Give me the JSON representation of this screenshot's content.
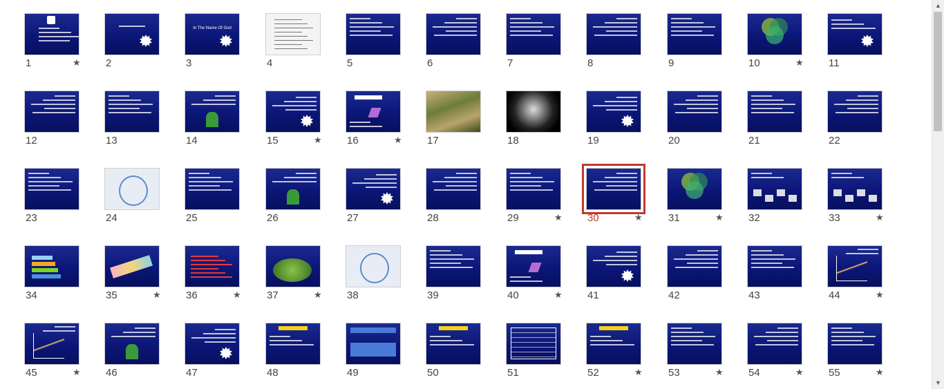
{
  "view": "slide-sorter",
  "selected_slide": "30",
  "star_glyph": "★",
  "colors": {
    "selection": "#c0392b",
    "slide_bg": "#0b1677"
  },
  "scrollbar": {
    "up_icon": "▲",
    "down_icon": "▼"
  },
  "slides": [
    {
      "n": "1",
      "star": true,
      "kind": "title-logo"
    },
    {
      "n": "2",
      "star": false,
      "kind": "title-burst"
    },
    {
      "n": "3",
      "star": false,
      "kind": "title-burst",
      "text": "In The Name Of God"
    },
    {
      "n": "4",
      "star": false,
      "kind": "document"
    },
    {
      "n": "5",
      "star": false,
      "kind": "text"
    },
    {
      "n": "6",
      "star": false,
      "kind": "text"
    },
    {
      "n": "7",
      "star": false,
      "kind": "text"
    },
    {
      "n": "8",
      "star": false,
      "kind": "text"
    },
    {
      "n": "9",
      "star": false,
      "kind": "text"
    },
    {
      "n": "10",
      "star": true,
      "kind": "venn"
    },
    {
      "n": "11",
      "star": false,
      "kind": "table-burst"
    },
    {
      "n": "12",
      "star": false,
      "kind": "text"
    },
    {
      "n": "13",
      "star": false,
      "kind": "text"
    },
    {
      "n": "14",
      "star": false,
      "kind": "figure"
    },
    {
      "n": "15",
      "star": true,
      "kind": "text-burst"
    },
    {
      "n": "16",
      "star": true,
      "kind": "diagram"
    },
    {
      "n": "17",
      "star": false,
      "kind": "photo-palm"
    },
    {
      "n": "18",
      "star": false,
      "kind": "photo-gear"
    },
    {
      "n": "19",
      "star": false,
      "kind": "text-burst"
    },
    {
      "n": "20",
      "star": false,
      "kind": "text"
    },
    {
      "n": "21",
      "star": false,
      "kind": "text"
    },
    {
      "n": "22",
      "star": false,
      "kind": "text"
    },
    {
      "n": "23",
      "star": false,
      "kind": "text"
    },
    {
      "n": "24",
      "star": false,
      "kind": "light"
    },
    {
      "n": "25",
      "star": false,
      "kind": "text"
    },
    {
      "n": "26",
      "star": false,
      "kind": "figure"
    },
    {
      "n": "27",
      "star": false,
      "kind": "text-burst"
    },
    {
      "n": "28",
      "star": false,
      "kind": "text"
    },
    {
      "n": "29",
      "star": true,
      "kind": "text"
    },
    {
      "n": "30",
      "star": true,
      "kind": "text"
    },
    {
      "n": "31",
      "star": true,
      "kind": "venn"
    },
    {
      "n": "32",
      "star": false,
      "kind": "computers"
    },
    {
      "n": "33",
      "star": true,
      "kind": "computers"
    },
    {
      "n": "34",
      "star": false,
      "kind": "arrows"
    },
    {
      "n": "35",
      "star": true,
      "kind": "ribbon"
    },
    {
      "n": "36",
      "star": true,
      "kind": "redtext"
    },
    {
      "n": "37",
      "star": true,
      "kind": "green"
    },
    {
      "n": "38",
      "star": false,
      "kind": "light"
    },
    {
      "n": "39",
      "star": false,
      "kind": "text"
    },
    {
      "n": "40",
      "star": true,
      "kind": "diagram"
    },
    {
      "n": "41",
      "star": false,
      "kind": "text-burst"
    },
    {
      "n": "42",
      "star": false,
      "kind": "text"
    },
    {
      "n": "43",
      "star": false,
      "kind": "text"
    },
    {
      "n": "44",
      "star": true,
      "kind": "chart"
    },
    {
      "n": "45",
      "star": true,
      "kind": "chart"
    },
    {
      "n": "46",
      "star": false,
      "kind": "figure"
    },
    {
      "n": "47",
      "star": false,
      "kind": "text-burst"
    },
    {
      "n": "48",
      "star": false,
      "kind": "yellow"
    },
    {
      "n": "49",
      "star": false,
      "kind": "boxes"
    },
    {
      "n": "50",
      "star": false,
      "kind": "yellow"
    },
    {
      "n": "51",
      "star": false,
      "kind": "table"
    },
    {
      "n": "52",
      "star": true,
      "kind": "yellow"
    },
    {
      "n": "53",
      "star": true,
      "kind": "text"
    },
    {
      "n": "54",
      "star": true,
      "kind": "text"
    },
    {
      "n": "55",
      "star": true,
      "kind": "text"
    }
  ]
}
